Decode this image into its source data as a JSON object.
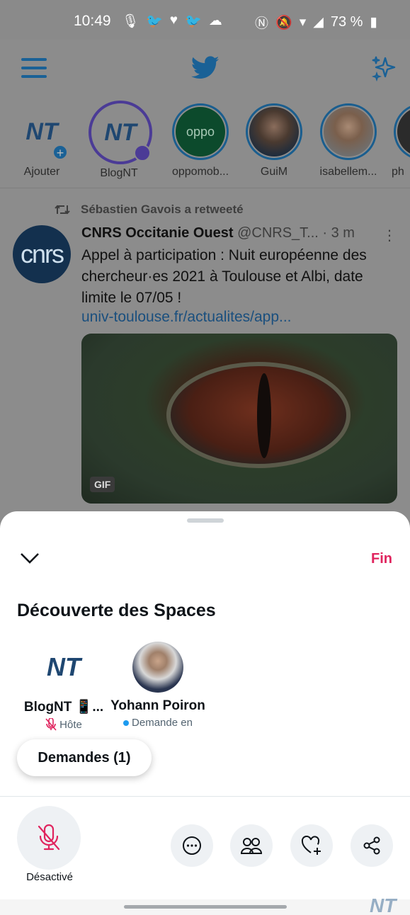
{
  "status_bar": {
    "time": "10:49",
    "battery": "73 %",
    "icons_left": [
      "mic-icon",
      "twitter-icon",
      "heart-icon",
      "twitter-icon",
      "cloud-icon"
    ],
    "icons_right": [
      "nfc-icon",
      "mute-icon",
      "wifi-icon",
      "signal-icon",
      "battery-icon"
    ]
  },
  "header": {
    "menu_icon": "hamburger-icon",
    "logo_icon": "twitter-bird-icon",
    "sparkle_icon": "sparkle-icon"
  },
  "fleets": [
    {
      "label": "Ajouter",
      "avatar": "NT"
    },
    {
      "label": "BlogNT",
      "avatar": "NT"
    },
    {
      "label": "oppomob...",
      "avatar": "oppo"
    },
    {
      "label": "GuiM",
      "avatar": ""
    },
    {
      "label": "isabellem...",
      "avatar": ""
    },
    {
      "label": "ph",
      "avatar": ""
    }
  ],
  "tweet": {
    "retweeted_by": "Sébastien Gavois a retweeté",
    "avatar_text": "cnrs",
    "author": "CNRS Occitanie Ouest",
    "handle": "@CNRS_T...",
    "time": "· 3 m",
    "text": "Appel à participation : Nuit européenne des chercheur·es 2021 à Toulouse et Albi, date limite le 07/05 !",
    "link": "univ-toulouse.fr/actualites/app...",
    "media_badge": "GIF"
  },
  "space": {
    "end_label": "Fin",
    "title": "Découverte des Spaces",
    "participants": [
      {
        "name": "BlogNT 📱...",
        "status": "Hôte",
        "avatar": "NT"
      },
      {
        "name": "Yohann Poiron",
        "status": "Demande en",
        "avatar": ""
      }
    ],
    "requests_label": "Demandes (1)",
    "mic_label": "Désactivé",
    "action_icons": [
      "more-icon",
      "people-icon",
      "heart-plus-icon",
      "share-icon"
    ]
  },
  "colors": {
    "accent": "#e0245e",
    "twitter_blue": "#1d9bf0",
    "overlay": "#8c8c8c"
  }
}
